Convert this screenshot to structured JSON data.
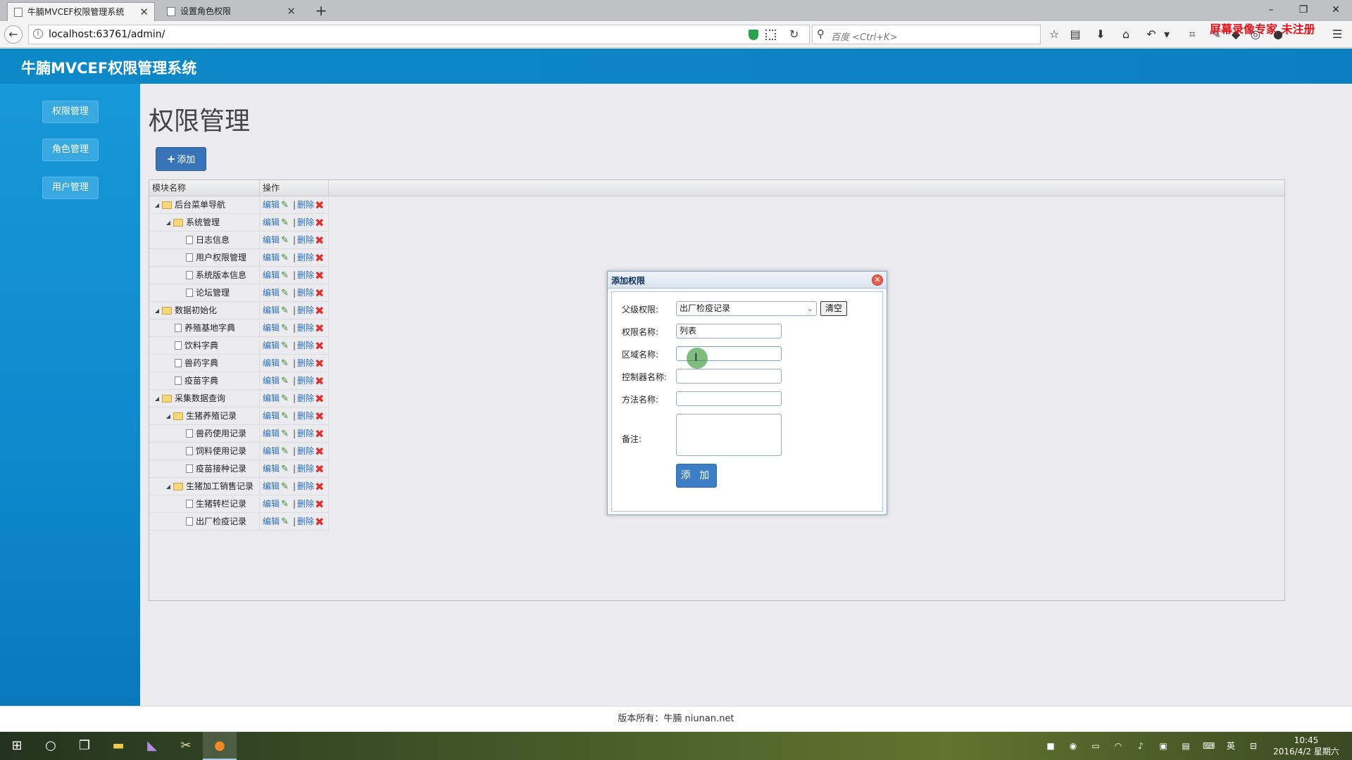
{
  "browser": {
    "tabs": [
      {
        "label": "牛腩MVCEF权限管理系统",
        "active": true
      },
      {
        "label": "设置角色权限",
        "active": false
      }
    ],
    "new_tab": "+",
    "window_controls": [
      "–",
      "❐",
      "✕"
    ],
    "back": "←",
    "url": "localhost:63761/admin/",
    "search_placeholder": "百度 <Ctrl+K>",
    "watermark": "屏幕录像专家 未注册"
  },
  "app": {
    "title": "牛腩MVCEF权限管理系统",
    "sidebar": [
      {
        "label": "权限管理"
      },
      {
        "label": "角色管理"
      },
      {
        "label": "用户管理"
      }
    ],
    "page_title": "权限管理",
    "add_button": "添加",
    "grid": {
      "columns": [
        "模块名称",
        "操作"
      ],
      "edit_label": "编辑",
      "delete_label": "删除",
      "separator": "|",
      "rows": [
        {
          "level": 0,
          "type": "folder",
          "label": "后台菜单导航"
        },
        {
          "level": 1,
          "type": "folder",
          "label": "系统管理"
        },
        {
          "level": 2,
          "type": "file",
          "label": "日志信息"
        },
        {
          "level": 2,
          "type": "file",
          "label": "用户权限管理"
        },
        {
          "level": 2,
          "type": "file",
          "label": "系统版本信息"
        },
        {
          "level": 2,
          "type": "file",
          "label": "论坛管理"
        },
        {
          "level": 0,
          "type": "folder",
          "label": "数据初始化"
        },
        {
          "level": 1,
          "type": "file",
          "label": "养殖基地字典"
        },
        {
          "level": 1,
          "type": "file",
          "label": "饮料字典"
        },
        {
          "level": 1,
          "type": "file",
          "label": "兽药字典"
        },
        {
          "level": 1,
          "type": "file",
          "label": "疫苗字典"
        },
        {
          "level": 0,
          "type": "folder",
          "label": "采集数据查询"
        },
        {
          "level": 1,
          "type": "folder",
          "label": "生猪养殖记录"
        },
        {
          "level": 2,
          "type": "file",
          "label": "兽药使用记录"
        },
        {
          "level": 2,
          "type": "file",
          "label": "饲料使用记录"
        },
        {
          "level": 2,
          "type": "file",
          "label": "疫苗接种记录"
        },
        {
          "level": 1,
          "type": "folder",
          "label": "生猪加工销售记录"
        },
        {
          "level": 2,
          "type": "file",
          "label": "生猪转栏记录"
        },
        {
          "level": 2,
          "type": "file",
          "label": "出厂检疫记录"
        }
      ]
    },
    "dialog": {
      "title": "添加权限",
      "parent_label": "父级权限:",
      "parent_value": "出厂检疫记录",
      "clear_button": "清空",
      "name_label": "权限名称:",
      "name_value": "列表",
      "area_label": "区域名称:",
      "area_value": "",
      "controller_label": "控制器名称:",
      "controller_value": "",
      "action_label": "方法名称:",
      "action_value": "",
      "remark_label": "备注:",
      "submit_button": "添 加"
    },
    "footer": "版本所有：牛腩 niunan.net"
  },
  "taskbar": {
    "time": "10:45",
    "date": "2016/4/2 星期六",
    "ime": "英"
  }
}
